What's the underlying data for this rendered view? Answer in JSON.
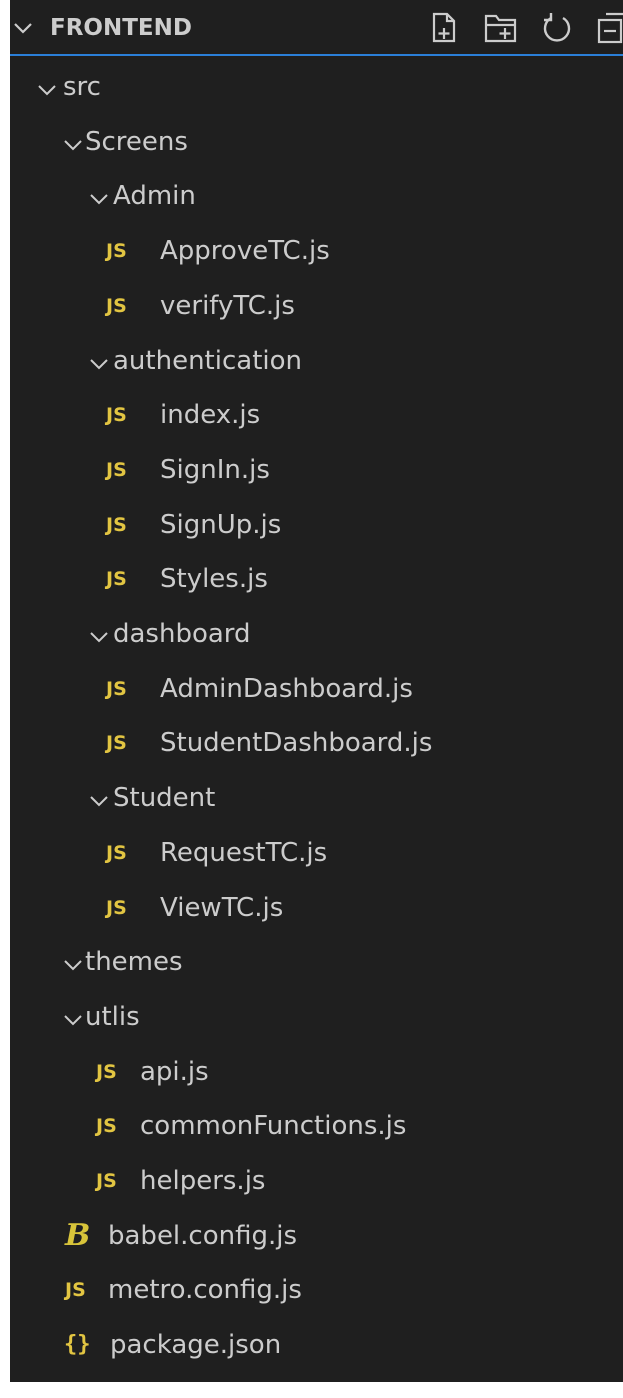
{
  "explorer": {
    "section_title": "FRONTEND",
    "actions": [
      "new-file",
      "new-folder",
      "refresh",
      "collapse-all"
    ]
  },
  "tree": [
    {
      "label": "src",
      "kind": "folder",
      "depth": 0
    },
    {
      "label": "Screens",
      "kind": "folder",
      "depth": 1
    },
    {
      "label": "Admin",
      "kind": "folder",
      "depth": 2
    },
    {
      "label": "ApproveTC.js",
      "kind": "js",
      "depth": 3,
      "badge": "JS"
    },
    {
      "label": "verifyTC.js",
      "kind": "js",
      "depth": 3,
      "badge": "JS"
    },
    {
      "label": "authentication",
      "kind": "folder",
      "depth": 2
    },
    {
      "label": "index.js",
      "kind": "js",
      "depth": 3,
      "badge": "JS"
    },
    {
      "label": "SignIn.js",
      "kind": "js",
      "depth": 3,
      "badge": "JS"
    },
    {
      "label": "SignUp.js",
      "kind": "js",
      "depth": 3,
      "badge": "JS"
    },
    {
      "label": "Styles.js",
      "kind": "js",
      "depth": 3,
      "badge": "JS"
    },
    {
      "label": "dashboard",
      "kind": "folder",
      "depth": 2
    },
    {
      "label": "AdminDashboard.js",
      "kind": "js",
      "depth": 3,
      "badge": "JS"
    },
    {
      "label": "StudentDashboard.js",
      "kind": "js",
      "depth": 3,
      "badge": "JS"
    },
    {
      "label": "Student",
      "kind": "folder",
      "depth": 2
    },
    {
      "label": "RequestTC.js",
      "kind": "js",
      "depth": 3,
      "badge": "JS"
    },
    {
      "label": "ViewTC.js",
      "kind": "js",
      "depth": 3,
      "badge": "JS"
    },
    {
      "label": "themes",
      "kind": "folder",
      "depth": 1
    },
    {
      "label": "utlis",
      "kind": "folder",
      "depth": 1
    },
    {
      "label": "api.js",
      "kind": "js",
      "depth": 2,
      "badge": "JS"
    },
    {
      "label": "commonFunctions.js",
      "kind": "js",
      "depth": 2,
      "badge": "JS"
    },
    {
      "label": "helpers.js",
      "kind": "js",
      "depth": 2,
      "badge": "JS"
    },
    {
      "label": "babel.config.js",
      "kind": "babel",
      "depth": 1,
      "badge": "B"
    },
    {
      "label": "metro.config.js",
      "kind": "js",
      "depth": 1,
      "badge": "JS"
    },
    {
      "label": "package.json",
      "kind": "json",
      "depth": 1,
      "badge": "{}"
    }
  ],
  "colors": {
    "background": "#1f1f1f",
    "text": "#cccccc",
    "js_badge": "#e2c542",
    "focus_border": "#2b7fd8"
  }
}
